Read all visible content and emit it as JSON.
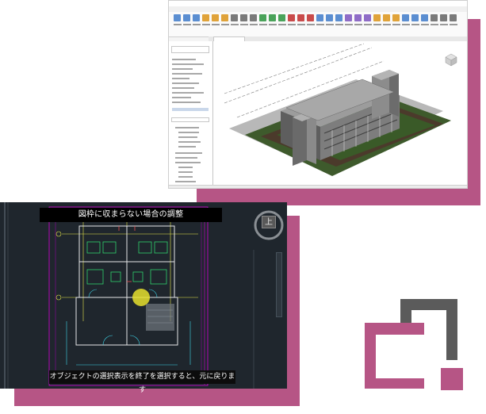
{
  "revit": {
    "ribbon_colors": [
      "#5b8ed1",
      "#e0a33a",
      "#7a7a7a",
      "#4aa35a",
      "#c94b4b",
      "#5b8ed1",
      "#8f6cc7",
      "#e0a33a",
      "#5b8ed1",
      "#7a7a7a"
    ]
  },
  "cad": {
    "banner_text": "図枠に収まらない場合の調整",
    "caption_text": "オブジェクトの選択表示を終了を選択すると、元に戻ります",
    "viewcube_label": "上"
  },
  "colors": {
    "accent_pink": "#b65585",
    "logo_gray": "#5b5b5b",
    "cad_background": "#1f262d"
  },
  "logo": {
    "icon": "overlapping-squares-icon"
  }
}
